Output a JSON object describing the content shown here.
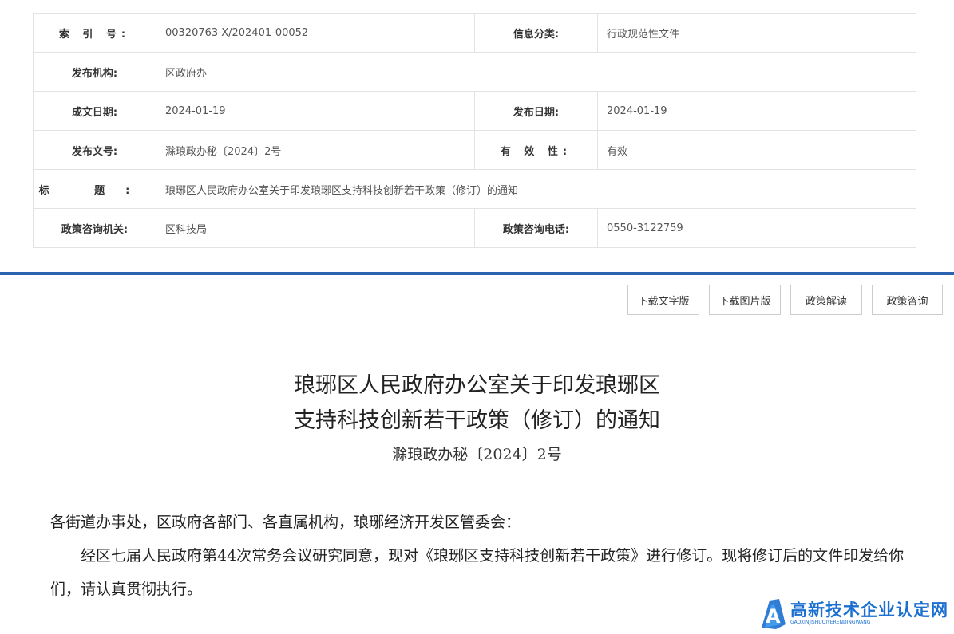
{
  "meta": {
    "rows": [
      {
        "l1": "索 引 号:",
        "v1": "00320763-X/202401-00052",
        "l2": "信息分类:",
        "v2": "行政规范性文件"
      },
      {
        "l1": "发布机构:",
        "v1": "区政府办"
      },
      {
        "l1": "成文日期:",
        "v1": "2024-01-19",
        "l2": "发布日期:",
        "v2": "2024-01-19"
      },
      {
        "l1": "发布文号:",
        "v1": "滁琅政办秘〔2024〕2号",
        "l2": "有 效 性:",
        "v2": "有效"
      },
      {
        "l1": "标 题:",
        "v1": "琅琊区人民政府办公室关于印发琅琊区支持科技创新若干政策（修订）的通知"
      },
      {
        "l1": "政策咨询机关:",
        "v1": "区科技局",
        "l2": "政策咨询电话:",
        "v2": "0550-3122759"
      }
    ]
  },
  "toolbar": {
    "download_text": "下载文字版",
    "download_image": "下载图片版",
    "interpretation": "政策解读",
    "consultation": "政策咨询"
  },
  "document": {
    "title_line1": "琅琊区人民政府办公室关于印发琅琊区",
    "title_line2": "支持科技创新若干政策（修订）的通知",
    "number": "滁琅政办秘〔2024〕2号",
    "salutation": "各街道办事处，区政府各部门、各直属机构，琅琊经济开发区管委会：",
    "body": "经区七届人民政府第44次常务会议研究同意，现对《琅琊区支持科技创新若干政策》进行修订。现将修订后的文件印发给你们，请认真贯彻执行。"
  },
  "watermark": {
    "logo_letter": "A",
    "name": "高新技术企业认定网",
    "pinyin": "GAOXINJISHUQIYERENDINGWANG"
  },
  "colors": {
    "divider": "#2a63b0",
    "watermark": "#1a6fd0"
  }
}
